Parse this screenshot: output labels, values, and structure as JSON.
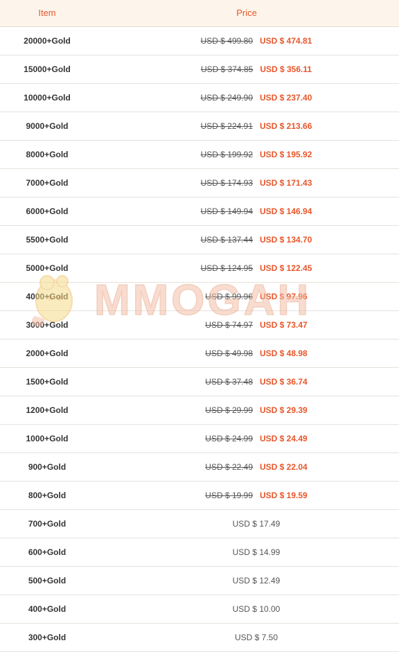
{
  "header": {
    "item_label": "Item",
    "price_label": "Price"
  },
  "watermark": {
    "text": "MMOGAH",
    "colors": {
      "primary": "#f4c0a8",
      "secondary": "#f7dc8a"
    }
  },
  "rows": [
    {
      "item": "20000+Gold",
      "old_price": "USD $ 499.80",
      "new_price": "USD $ 474.81",
      "price": ""
    },
    {
      "item": "15000+Gold",
      "old_price": "USD $ 374.85",
      "new_price": "USD $ 356.11",
      "price": ""
    },
    {
      "item": "10000+Gold",
      "old_price": "USD $ 249.90",
      "new_price": "USD $ 237.40",
      "price": ""
    },
    {
      "item": "9000+Gold",
      "old_price": "USD $ 224.91",
      "new_price": "USD $ 213.66",
      "price": ""
    },
    {
      "item": "8000+Gold",
      "old_price": "USD $ 199.92",
      "new_price": "USD $ 195.92",
      "price": ""
    },
    {
      "item": "7000+Gold",
      "old_price": "USD $ 174.93",
      "new_price": "USD $ 171.43",
      "price": ""
    },
    {
      "item": "6000+Gold",
      "old_price": "USD $ 149.94",
      "new_price": "USD $ 146.94",
      "price": ""
    },
    {
      "item": "5500+Gold",
      "old_price": "USD $ 137.44",
      "new_price": "USD $ 134.70",
      "price": ""
    },
    {
      "item": "5000+Gold",
      "old_price": "USD $ 124.95",
      "new_price": "USD $ 122.45",
      "price": ""
    },
    {
      "item": "4000+Gold",
      "old_price": "USD $ 99.96",
      "new_price": "USD $ 97.96",
      "price": ""
    },
    {
      "item": "3000+Gold",
      "old_price": "USD $ 74.97",
      "new_price": "USD $ 73.47",
      "price": ""
    },
    {
      "item": "2000+Gold",
      "old_price": "USD $ 49.98",
      "new_price": "USD $ 48.98",
      "price": ""
    },
    {
      "item": "1500+Gold",
      "old_price": "USD $ 37.48",
      "new_price": "USD $ 36.74",
      "price": ""
    },
    {
      "item": "1200+Gold",
      "old_price": "USD $ 29.99",
      "new_price": "USD $ 29.39",
      "price": ""
    },
    {
      "item": "1000+Gold",
      "old_price": "USD $ 24.99",
      "new_price": "USD $ 24.49",
      "price": ""
    },
    {
      "item": "900+Gold",
      "old_price": "USD $ 22.49",
      "new_price": "USD $ 22.04",
      "price": ""
    },
    {
      "item": "800+Gold",
      "old_price": "USD $ 19.99",
      "new_price": "USD $ 19.59",
      "price": ""
    },
    {
      "item": "700+Gold",
      "old_price": "",
      "new_price": "",
      "price": "USD $ 17.49"
    },
    {
      "item": "600+Gold",
      "old_price": "",
      "new_price": "",
      "price": "USD $ 14.99"
    },
    {
      "item": "500+Gold",
      "old_price": "",
      "new_price": "",
      "price": "USD $ 12.49"
    },
    {
      "item": "400+Gold",
      "old_price": "",
      "new_price": "",
      "price": "USD $ 10.00"
    },
    {
      "item": "300+Gold",
      "old_price": "",
      "new_price": "",
      "price": "USD $ 7.50"
    }
  ]
}
